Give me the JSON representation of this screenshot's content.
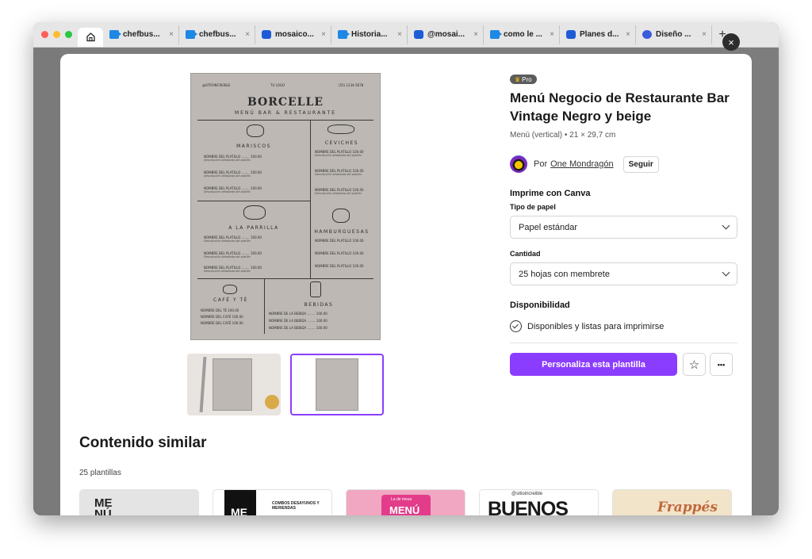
{
  "browser": {
    "tabs": [
      {
        "label": "chefbus...",
        "icon": "video-icon"
      },
      {
        "label": "chefbus...",
        "icon": "video-icon"
      },
      {
        "label": "mosaico...",
        "icon": "chat-icon"
      },
      {
        "label": "Historia...",
        "icon": "video-icon"
      },
      {
        "label": "@mosai...",
        "icon": "chat-icon"
      },
      {
        "label": "como le ...",
        "icon": "video-icon"
      },
      {
        "label": "Planes d...",
        "icon": "chat-icon"
      },
      {
        "label": "Diseño ...",
        "icon": "canva-icon"
      }
    ],
    "close_glyph": "×",
    "new_tab_glyph": "+",
    "traffic_colors": [
      "#fe5f57",
      "#febc2e",
      "#28c840"
    ]
  },
  "modal": {
    "close_glyph": "×",
    "template": {
      "badge": "Pro",
      "badge_icon": "♛",
      "title": "Menú Negocio de Restaurante Bar Vintage Negro y beige",
      "subtitle": "Menú (vertical) • 21 × 29,7 cm",
      "author_prefix": "Por",
      "author": "One Mondragón",
      "follow_label": "Seguir"
    },
    "print": {
      "heading": "Imprime con Canva",
      "paper_label": "Tipo de papel",
      "paper_value": "Papel estándar",
      "quantity_label": "Cantidad",
      "quantity_value": "25 hojas con membrete"
    },
    "availability": {
      "heading": "Disponibilidad",
      "text": "Disponibles y listas para imprimirse"
    },
    "actions": {
      "customize_label": "Personaliza esta plantilla",
      "star_glyph": "☆",
      "more_glyph": "•••",
      "accent": "#8b3dff"
    },
    "similar": {
      "title": "Contenido similar",
      "count": "25 plantillas",
      "cards": [
        "ME NÚ",
        "ME",
        "MENÚ",
        "BUENOS",
        "Frappés"
      ],
      "card2_caption": "COMBOS DESAYUNOS Y MERIENDAS",
      "card3_tag": "La de mesa",
      "card4_handle": "@sitioincreible"
    }
  },
  "menu_preview": {
    "handle": "@SITIOINCREIBLE",
    "logo_text": "TU LOGO",
    "phone": "(55) 1234-5678",
    "brand": "BORCELLE",
    "tagline": "MENÚ BAR & RESTAURANTE",
    "sections": {
      "mariscos": "MARISCOS",
      "ceviches": "CEVICHES",
      "parrilla": "A LA PARRILLA",
      "hamburguesas": "HAMBURGUESAS",
      "cafe": "CAFÉ Y TÉ",
      "bebidas": "BEBIDAS"
    },
    "dish": "NOMBRE DEL PLATILLO",
    "price": "100.00",
    "desc": "Descripción detallada del platillo",
    "cafe_items": [
      "NOMBRE DEL TÉ",
      "NOMBRE DEL CAFÉ",
      "NOMBRE DEL CAFÉ"
    ],
    "drink": "NOMBRE DE LA BEBIDA"
  }
}
